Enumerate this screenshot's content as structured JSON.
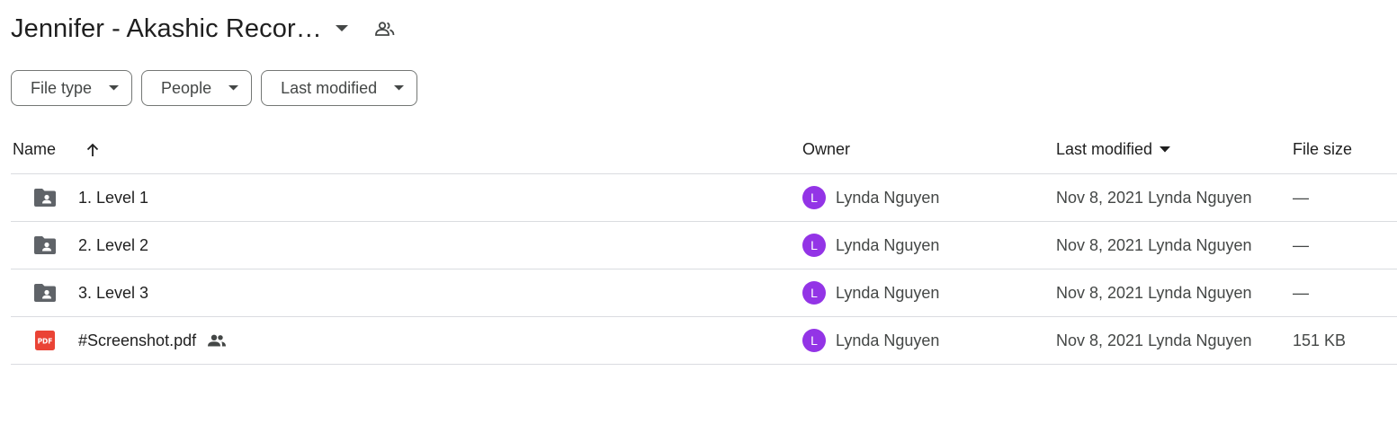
{
  "folder": {
    "title": "Jennifer - Akashic Recor…"
  },
  "filters": [
    {
      "label": "File type"
    },
    {
      "label": "People"
    },
    {
      "label": "Last modified"
    }
  ],
  "columns": {
    "name": "Name",
    "owner": "Owner",
    "last_modified": "Last modified",
    "file_size": "File size"
  },
  "files": [
    {
      "name": "1. Level 1",
      "icon": "shared-folder-icon",
      "owner": "Lynda Nguyen",
      "owner_initial": "L",
      "modified_date": "Nov 8, 2021",
      "modified_by": "Lynda Nguyen",
      "size": "—"
    },
    {
      "name": "2. Level 2",
      "icon": "shared-folder-icon",
      "owner": "Lynda Nguyen",
      "owner_initial": "L",
      "modified_date": "Nov 8, 2021",
      "modified_by": "Lynda Nguyen",
      "size": "—"
    },
    {
      "name": "3. Level 3",
      "icon": "shared-folder-icon",
      "owner": "Lynda Nguyen",
      "owner_initial": "L",
      "modified_date": "Nov 8, 2021",
      "modified_by": "Lynda Nguyen",
      "size": "—"
    },
    {
      "name": "#Screenshot.pdf",
      "icon": "pdf-file-icon",
      "owner": "Lynda Nguyen",
      "owner_initial": "L",
      "modified_date": "Nov 8, 2021",
      "modified_by": "Lynda Nguyen",
      "size": "151 KB"
    }
  ],
  "colors": {
    "avatar": "#9334e6",
    "folder_icon": "#5f6368",
    "pdf_icon": "#ea4335",
    "icon_dark": "#444746"
  }
}
